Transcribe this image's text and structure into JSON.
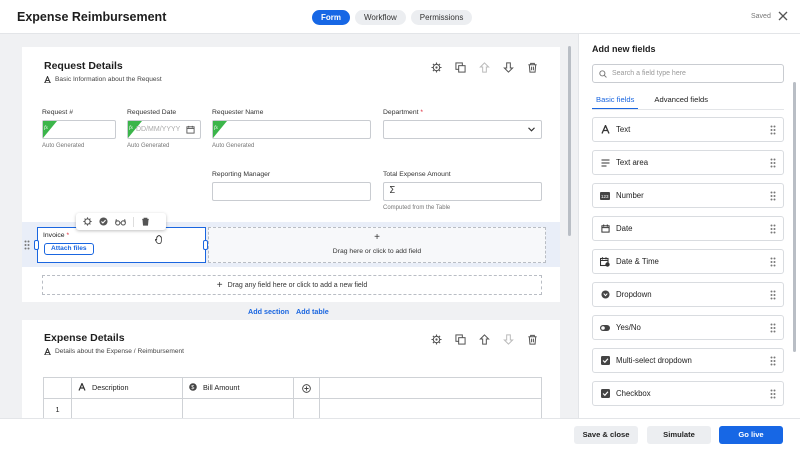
{
  "app": {
    "title": "Expense Reimbursement",
    "saved": "Saved"
  },
  "tabs": [
    {
      "label": "Form"
    },
    {
      "label": "Workflow"
    },
    {
      "label": "Permissions"
    }
  ],
  "request_section": {
    "title": "Request Details",
    "description": "Basic Information about the Request",
    "fields": {
      "request_no": {
        "label": "Request #",
        "note": "Auto Generated"
      },
      "requested_date": {
        "label": "Requested Date",
        "placeholder": "DD/MM/YYYY",
        "note": "Auto Generated"
      },
      "requester_name": {
        "label": "Requester Name",
        "note": "Auto Generated"
      },
      "department": {
        "label": "Department",
        "required": "*"
      },
      "reporting_manager": {
        "label": "Reporting Manager"
      },
      "total_expense": {
        "label": "Total Expense Amount",
        "note": "Computed from the Table"
      },
      "invoice": {
        "label": "Invoice",
        "required": "*",
        "button": "Attach files"
      }
    },
    "dropzone_text": "Drag here or click to add field",
    "add_field_text": "Drag any field here or click to add a new field"
  },
  "links": {
    "add_section": "Add section",
    "add_table": "Add table"
  },
  "expense_section": {
    "title": "Expense Details",
    "description": "Details about the Expense / Reimbursement",
    "table": {
      "columns": [
        "Description",
        "Bill Amount"
      ],
      "row_numbers": [
        "1"
      ]
    }
  },
  "panel": {
    "title": "Add new fields",
    "search_placeholder": "Search a field type here",
    "tabs": [
      "Basic fields",
      "Advanced fields"
    ],
    "items": [
      {
        "label": "Text",
        "icon": "text-icon"
      },
      {
        "label": "Text area",
        "icon": "textarea-icon"
      },
      {
        "label": "Number",
        "icon": "number-icon"
      },
      {
        "label": "Date",
        "icon": "calendar-icon"
      },
      {
        "label": "Date & Time",
        "icon": "calendar-clock-icon"
      },
      {
        "label": "Dropdown",
        "icon": "dropdown-icon"
      },
      {
        "label": "Yes/No",
        "icon": "toggle-icon"
      },
      {
        "label": "Multi-select dropdown",
        "icon": "checked-box-icon"
      },
      {
        "label": "Checkbox",
        "icon": "checkbox-icon"
      }
    ]
  },
  "footer": {
    "save_close": "Save & close",
    "simulate": "Simulate",
    "go_live": "Go live"
  },
  "colors": {
    "accent": "#1767e5",
    "formula": "#3bb54a",
    "selection": "#e9eef8"
  }
}
